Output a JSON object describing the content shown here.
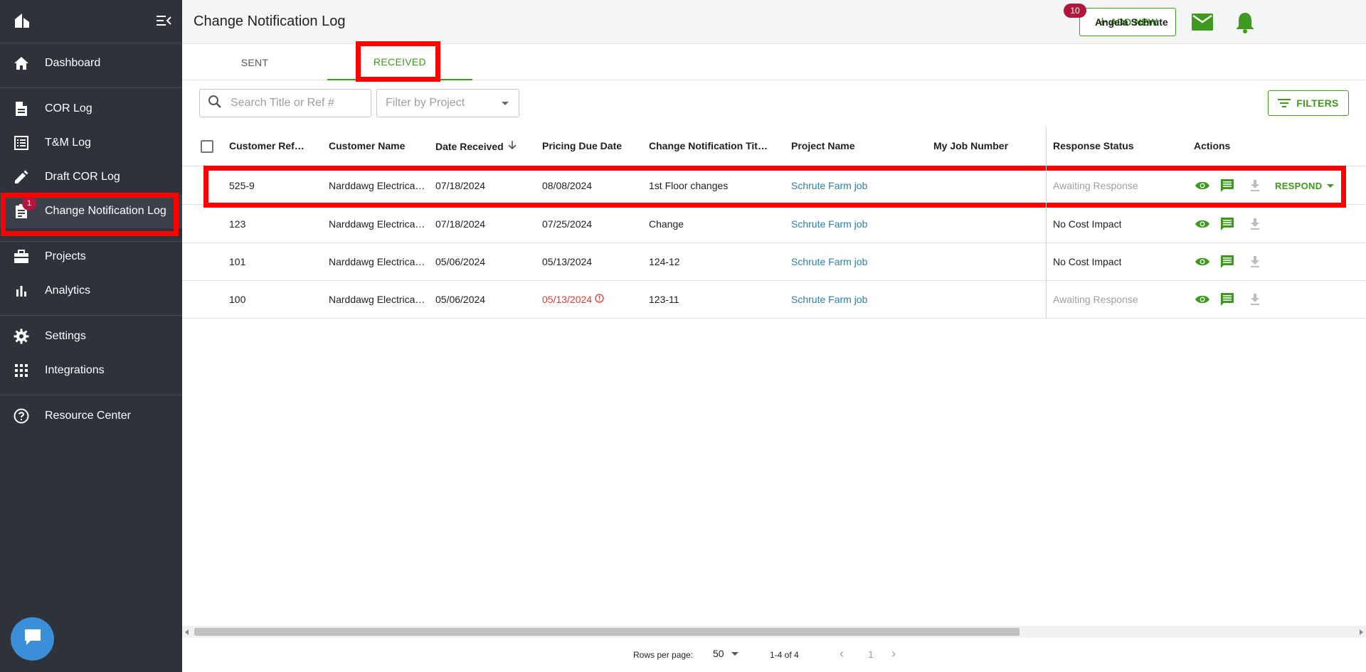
{
  "colors": {
    "accent": "#3d9a1c",
    "sidebar_bg": "#2e323b",
    "badge": "#b0173b",
    "link": "#2f7fa8",
    "overdue": "#e53935",
    "highlight": "#ff0000"
  },
  "sidebar": {
    "items": [
      {
        "label": "Dashboard",
        "icon": "home-icon"
      },
      {
        "label": "COR Log",
        "icon": "document-icon"
      },
      {
        "label": "T&M Log",
        "icon": "list-icon"
      },
      {
        "label": "Draft COR Log",
        "icon": "pencil-icon"
      },
      {
        "label": "Change Notification Log",
        "icon": "assignment-icon",
        "badge": "1"
      },
      {
        "label": "Projects",
        "icon": "briefcase-icon"
      },
      {
        "label": "Analytics",
        "icon": "bar-chart-icon"
      },
      {
        "label": "Settings",
        "icon": "gear-icon"
      },
      {
        "label": "Integrations",
        "icon": "apps-grid-icon"
      },
      {
        "label": "Resource Center",
        "icon": "help-circle-icon"
      }
    ]
  },
  "header": {
    "title": "Change Notification Log",
    "add_new_label": "ADD NEW",
    "notifications_count": "10",
    "user_name": "Angela Schrute"
  },
  "tabs": [
    {
      "label": "SENT",
      "active": false
    },
    {
      "label": "RECEIVED",
      "active": true
    }
  ],
  "toolbar": {
    "search_placeholder": "Search Title or Ref #",
    "project_filter_placeholder": "Filter by Project",
    "filters_label": "FILTERS"
  },
  "table": {
    "columns": [
      "Customer Ref…",
      "Customer Name",
      "Date Received",
      "Pricing Due Date",
      "Change Notification Tit…",
      "Project Name",
      "My Job Number",
      "Response Status",
      "Actions"
    ],
    "rows": [
      {
        "ref": "525-9",
        "customer": "Narddawg Electrica…",
        "date_received": "07/18/2024",
        "pricing_due": "08/08/2024",
        "title": "1st Floor changes",
        "project": "Schrute Farm job",
        "job_number": "",
        "status": "Awaiting Response"
      },
      {
        "ref": "123",
        "customer": "Narddawg Electrica…",
        "date_received": "07/18/2024",
        "pricing_due": "07/25/2024",
        "title": "Change",
        "project": "Schrute Farm job",
        "job_number": "",
        "status": "No Cost Impact"
      },
      {
        "ref": "101",
        "customer": "Narddawg Electrica…",
        "date_received": "05/06/2024",
        "pricing_due": "05/13/2024",
        "title": "124-12",
        "project": "Schrute Farm job",
        "job_number": "",
        "status": "No Cost Impact"
      },
      {
        "ref": "100",
        "customer": "Narddawg Electrica…",
        "date_received": "05/06/2024",
        "pricing_due": "05/13/2024",
        "title": "123-11",
        "project": "Schrute Farm job",
        "job_number": "",
        "status": "Awaiting Response"
      }
    ],
    "respond_label": "RESPOND"
  },
  "pagination": {
    "rows_per_page_label": "Rows per page:",
    "rows_per_page": "50",
    "range": "1-4 of 4",
    "page": "1"
  }
}
